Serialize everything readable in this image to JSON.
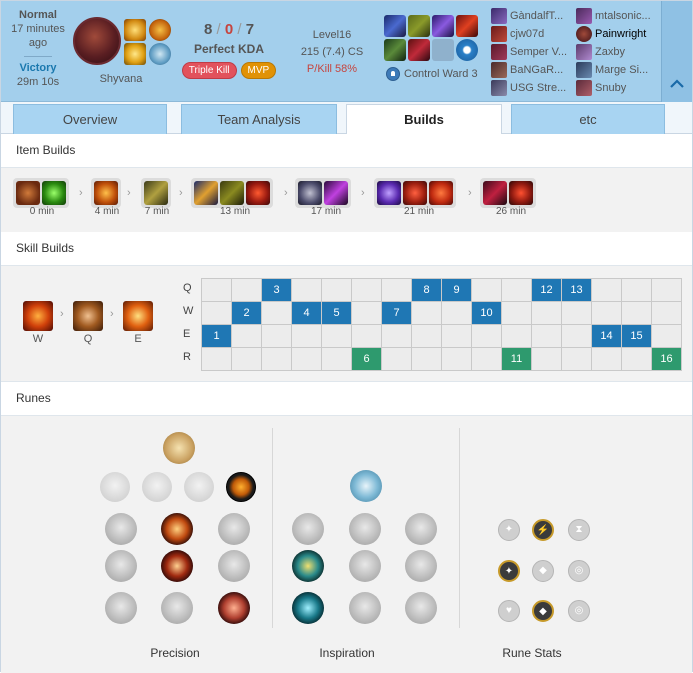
{
  "header": {
    "game_type": "Normal",
    "time_ago": "17 minutes ago",
    "result": "Victory",
    "duration": "29m 10s",
    "champion_name": "Shyvana",
    "kda": {
      "kills": "8",
      "deaths": "0",
      "assists": "7",
      "sep": "/"
    },
    "kda_ratio": "Perfect KDA",
    "badges": {
      "multikill": "Triple Kill",
      "mvp": "MVP"
    },
    "level": "Level16",
    "cs": "215 (7.4) CS",
    "pkill": "P/Kill 58%",
    "control_ward": "Control Ward 3"
  },
  "team_blue": [
    {
      "name": "GàndalfT..."
    },
    {
      "name": "cjw07d"
    },
    {
      "name": "Semper V..."
    },
    {
      "name": "BaNGaR..."
    },
    {
      "name": "USG Stre..."
    }
  ],
  "team_red": [
    {
      "name": "mtalsonic..."
    },
    {
      "name": "Painwright"
    },
    {
      "name": "Zaxby"
    },
    {
      "name": "Marge Si..."
    },
    {
      "name": "Snuby"
    }
  ],
  "tabs": [
    "Overview",
    "Team Analysis",
    "Builds",
    "etc"
  ],
  "active_tab": "Builds",
  "sections": {
    "item_builds": "Item Builds",
    "skill_builds": "Skill Builds",
    "runes": "Runes"
  },
  "item_builds": [
    {
      "time": "0 min",
      "items": [
        "dorans-ring",
        "potion"
      ]
    },
    {
      "time": "4 min",
      "items": [
        "kindlegem"
      ]
    },
    {
      "time": "7 min",
      "items": [
        "boots"
      ]
    },
    {
      "time": "13 min",
      "items": [
        "staff",
        "sorcerer-boots",
        "rod"
      ]
    },
    {
      "time": "17 min",
      "items": [
        "hourglass",
        "scythe"
      ]
    },
    {
      "time": "21 min",
      "items": [
        "orb",
        "liandry",
        "needlessly-large-rod"
      ]
    },
    {
      "time": "26 min",
      "items": [
        "morello",
        "mask"
      ]
    }
  ],
  "skill_order": [
    {
      "key": "W",
      "icon": "shyvana-w-icon"
    },
    {
      "key": "Q",
      "icon": "shyvana-q-icon"
    },
    {
      "key": "E",
      "icon": "shyvana-e-icon"
    }
  ],
  "skill_levels": {
    "rows": [
      "Q",
      "W",
      "E",
      "R"
    ],
    "Q": [
      3,
      8,
      9,
      12,
      13
    ],
    "W": [
      2,
      4,
      5,
      7,
      10
    ],
    "E": [
      1,
      14,
      15
    ],
    "R": [
      6,
      11,
      16
    ],
    "total": 16
  },
  "rune_trees": {
    "primary": "Precision",
    "secondary": "Inspiration",
    "stats": "Rune Stats"
  },
  "colors": {
    "header_bg": "#a3cfec",
    "victory": "#1a78ae",
    "deaths": "#c6443e",
    "skill_cell": "#1f77b4",
    "ult_cell": "#2e9a6e",
    "mvp": "#e19205",
    "multikill": "#e2525c"
  }
}
